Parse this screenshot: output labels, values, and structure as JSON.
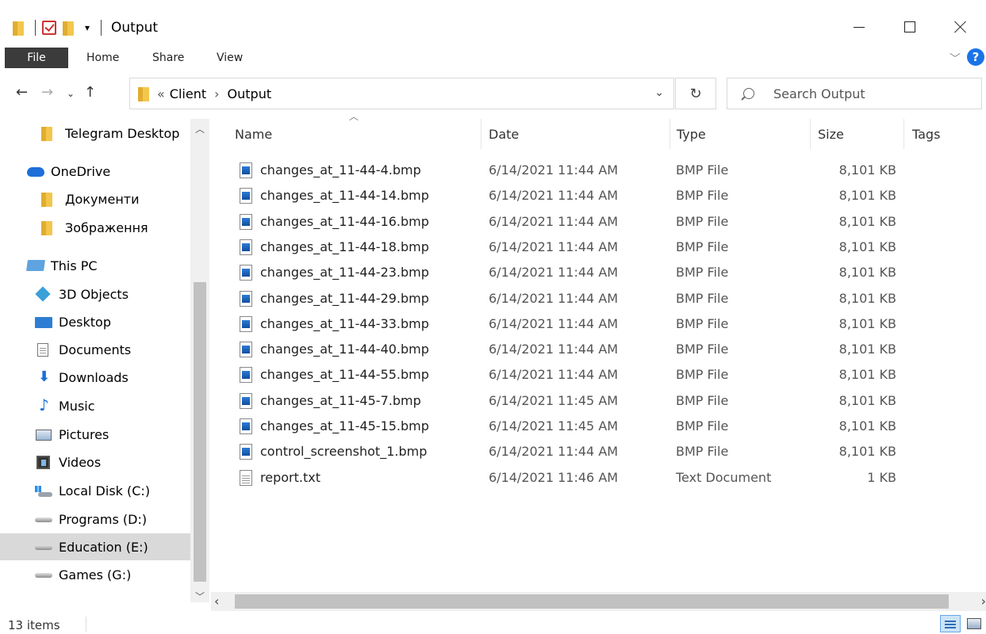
{
  "window": {
    "title": "Output"
  },
  "ribbon": {
    "tabs": [
      "File",
      "Home",
      "Share",
      "View"
    ],
    "help": "?"
  },
  "address": {
    "prefix": "«",
    "crumbs": [
      "Client",
      "Output"
    ]
  },
  "search": {
    "placeholder": "Search Output"
  },
  "nav": {
    "items": [
      {
        "label": "Telegram Desktop",
        "icon": "folder-icon"
      },
      {
        "label": "OneDrive",
        "icon": "onedrive-icon"
      },
      {
        "label": "Документи",
        "icon": "folder-icon"
      },
      {
        "label": "Зображення",
        "icon": "folder-icon"
      },
      {
        "label": "This PC",
        "icon": "this-pc-icon"
      },
      {
        "label": "3D Objects",
        "icon": "3d-objects-icon"
      },
      {
        "label": "Desktop",
        "icon": "desktop-icon"
      },
      {
        "label": "Documents",
        "icon": "documents-icon"
      },
      {
        "label": "Downloads",
        "icon": "downloads-icon"
      },
      {
        "label": "Music",
        "icon": "music-icon"
      },
      {
        "label": "Pictures",
        "icon": "pictures-icon"
      },
      {
        "label": "Videos",
        "icon": "videos-icon"
      },
      {
        "label": "Local Disk (C:)",
        "icon": "windows-disk-icon"
      },
      {
        "label": "Programs (D:)",
        "icon": "drive-icon"
      },
      {
        "label": "Education (E:)",
        "icon": "drive-icon"
      },
      {
        "label": "Games (G:)",
        "icon": "drive-icon"
      }
    ]
  },
  "columns": {
    "name": "Name",
    "date": "Date",
    "type": "Type",
    "size": "Size",
    "tags": "Tags"
  },
  "files": [
    {
      "name": "changes_at_11-44-4.bmp",
      "date": "6/14/2021 11:44 AM",
      "type": "BMP File",
      "size": "8,101 KB",
      "icon": "bmp-file-icon"
    },
    {
      "name": "changes_at_11-44-14.bmp",
      "date": "6/14/2021 11:44 AM",
      "type": "BMP File",
      "size": "8,101 KB",
      "icon": "bmp-file-icon"
    },
    {
      "name": "changes_at_11-44-16.bmp",
      "date": "6/14/2021 11:44 AM",
      "type": "BMP File",
      "size": "8,101 KB",
      "icon": "bmp-file-icon"
    },
    {
      "name": "changes_at_11-44-18.bmp",
      "date": "6/14/2021 11:44 AM",
      "type": "BMP File",
      "size": "8,101 KB",
      "icon": "bmp-file-icon"
    },
    {
      "name": "changes_at_11-44-23.bmp",
      "date": "6/14/2021 11:44 AM",
      "type": "BMP File",
      "size": "8,101 KB",
      "icon": "bmp-file-icon"
    },
    {
      "name": "changes_at_11-44-29.bmp",
      "date": "6/14/2021 11:44 AM",
      "type": "BMP File",
      "size": "8,101 KB",
      "icon": "bmp-file-icon"
    },
    {
      "name": "changes_at_11-44-33.bmp",
      "date": "6/14/2021 11:44 AM",
      "type": "BMP File",
      "size": "8,101 KB",
      "icon": "bmp-file-icon"
    },
    {
      "name": "changes_at_11-44-40.bmp",
      "date": "6/14/2021 11:44 AM",
      "type": "BMP File",
      "size": "8,101 KB",
      "icon": "bmp-file-icon"
    },
    {
      "name": "changes_at_11-44-55.bmp",
      "date": "6/14/2021 11:44 AM",
      "type": "BMP File",
      "size": "8,101 KB",
      "icon": "bmp-file-icon"
    },
    {
      "name": "changes_at_11-45-7.bmp",
      "date": "6/14/2021 11:45 AM",
      "type": "BMP File",
      "size": "8,101 KB",
      "icon": "bmp-file-icon"
    },
    {
      "name": "changes_at_11-45-15.bmp",
      "date": "6/14/2021 11:45 AM",
      "type": "BMP File",
      "size": "8,101 KB",
      "icon": "bmp-file-icon"
    },
    {
      "name": "control_screenshot_1.bmp",
      "date": "6/14/2021 11:44 AM",
      "type": "BMP File",
      "size": "8,101 KB",
      "icon": "bmp-file-icon"
    },
    {
      "name": "report.txt",
      "date": "6/14/2021 11:46 AM",
      "type": "Text Document",
      "size": "1 KB",
      "icon": "text-file-icon"
    }
  ],
  "status": {
    "count": "13 items"
  },
  "colors": {
    "file_tab_bg": "#3b3b3b",
    "selection": "#d9d9d9",
    "help": "#1a73e8"
  }
}
